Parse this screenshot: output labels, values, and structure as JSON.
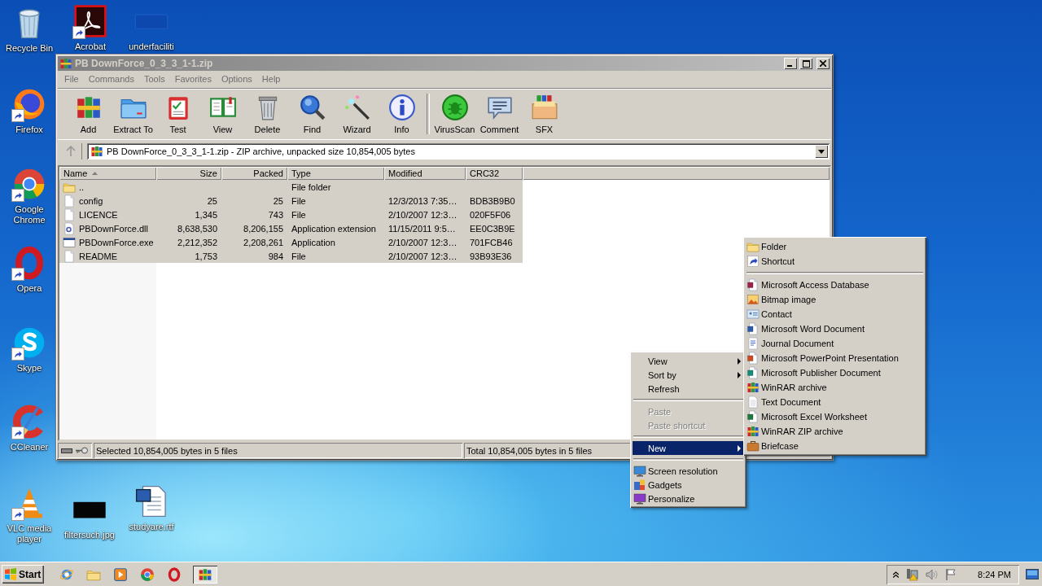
{
  "desktop_icons": [
    {
      "label": "Recycle Bin",
      "kind": "recycle",
      "shortcut": false
    },
    {
      "label": "Acrobat",
      "kind": "acrobat",
      "shortcut": true
    },
    {
      "label": "underfaciliti",
      "kind": "blank",
      "shortcut": false
    },
    {
      "label": "Firefox",
      "kind": "firefox",
      "shortcut": true
    },
    {
      "label": "Google Chrome",
      "kind": "chrome",
      "shortcut": true
    },
    {
      "label": "Opera",
      "kind": "opera",
      "shortcut": true
    },
    {
      "label": "Skype",
      "kind": "skype",
      "shortcut": true
    },
    {
      "label": "CCleaner",
      "kind": "ccleaner",
      "shortcut": true
    },
    {
      "label": "VLC media player",
      "kind": "vlc",
      "shortcut": true
    },
    {
      "label": "filtersuch.jpg",
      "kind": "image",
      "shortcut": false
    },
    {
      "label": "studyare.rtf",
      "kind": "word",
      "shortcut": false
    }
  ],
  "window": {
    "title": "PB DownForce_0_3_3_1-1.zip",
    "menu": [
      "File",
      "Commands",
      "Tools",
      "Favorites",
      "Options",
      "Help"
    ],
    "toolbar_groups": [
      [
        {
          "label": "Add",
          "kind": "add"
        },
        {
          "label": "Extract To",
          "kind": "extract"
        },
        {
          "label": "Test",
          "kind": "test"
        },
        {
          "label": "View",
          "kind": "view"
        },
        {
          "label": "Delete",
          "kind": "delete"
        },
        {
          "label": "Find",
          "kind": "find"
        },
        {
          "label": "Wizard",
          "kind": "wizard"
        },
        {
          "label": "Info",
          "kind": "info"
        }
      ],
      [
        {
          "label": "VirusScan",
          "kind": "virusscan"
        },
        {
          "label": "Comment",
          "kind": "comment"
        },
        {
          "label": "SFX",
          "kind": "sfx"
        }
      ]
    ],
    "address": "PB DownForce_0_3_3_1-1.zip - ZIP archive, unpacked size 10,854,005 bytes",
    "columns": [
      {
        "label": "Name",
        "sorted": true
      },
      {
        "label": "Size",
        "sorted": false
      },
      {
        "label": "Packed",
        "sorted": false
      },
      {
        "label": "Type",
        "sorted": false
      },
      {
        "label": "Modified",
        "sorted": false
      },
      {
        "label": "CRC32",
        "sorted": false
      }
    ],
    "rows": [
      {
        "kind": "folder",
        "name": "..",
        "type": "File folder",
        "selected": true
      },
      {
        "kind": "file",
        "name": "config",
        "size": "25",
        "packed": "25",
        "type": "File",
        "modified": "12/3/2013 7:35…",
        "crc32": "BDB3B9B0",
        "selected": true
      },
      {
        "kind": "file",
        "name": "LICENCE",
        "size": "1,345",
        "packed": "743",
        "type": "File",
        "modified": "2/10/2007 12:3…",
        "crc32": "020F5F06",
        "selected": true
      },
      {
        "kind": "dll",
        "name": "PBDownForce.dll",
        "size": "8,638,530",
        "packed": "8,206,155",
        "type": "Application extension",
        "modified": "11/15/2011 9:5…",
        "crc32": "EE0C3B9E",
        "selected": true
      },
      {
        "kind": "exe",
        "name": "PBDownForce.exe",
        "size": "2,212,352",
        "packed": "2,208,261",
        "type": "Application",
        "modified": "2/10/2007 12:3…",
        "crc32": "701FCB46",
        "selected": true
      },
      {
        "kind": "file",
        "name": "README",
        "size": "1,753",
        "packed": "984",
        "type": "File",
        "modified": "2/10/2007 12:3…",
        "crc32": "93B93E36",
        "selected": true
      }
    ],
    "status": {
      "selected": "Selected 10,854,005 bytes in 5 files",
      "total": "Total 10,854,005 bytes in 5 files"
    }
  },
  "context_menu": {
    "items": [
      {
        "kind": "item",
        "label": "View",
        "submenu": true,
        "disabled": false,
        "selected": false
      },
      {
        "kind": "item",
        "label": "Sort by",
        "submenu": true,
        "disabled": false,
        "selected": false
      },
      {
        "kind": "item",
        "label": "Refresh",
        "submenu": false,
        "disabled": false,
        "selected": false
      },
      {
        "kind": "separator"
      },
      {
        "kind": "item",
        "label": "Paste",
        "submenu": false,
        "disabled": true,
        "selected": false
      },
      {
        "kind": "item",
        "label": "Paste shortcut",
        "submenu": false,
        "disabled": true,
        "selected": false
      },
      {
        "kind": "separator"
      },
      {
        "kind": "item",
        "label": "New",
        "submenu": true,
        "disabled": false,
        "selected": true
      },
      {
        "kind": "separator"
      },
      {
        "kind": "screen",
        "label": "Screen resolution",
        "submenu": false,
        "disabled": false,
        "selected": false
      },
      {
        "kind": "gadgets",
        "label": "Gadgets",
        "submenu": false,
        "disabled": false,
        "selected": false
      },
      {
        "kind": "personalize",
        "label": "Personalize",
        "submenu": false,
        "disabled": false,
        "selected": false
      }
    ]
  },
  "new_submenu": {
    "items": [
      {
        "kind": "folder",
        "label": "Folder"
      },
      {
        "kind": "shortcut",
        "label": "Shortcut"
      },
      {
        "kind": "separator"
      },
      {
        "kind": "access",
        "label": "Microsoft Access Database"
      },
      {
        "kind": "bitmap",
        "label": "Bitmap image"
      },
      {
        "kind": "contact",
        "label": "Contact"
      },
      {
        "kind": "worddoc",
        "label": "Microsoft Word Document"
      },
      {
        "kind": "journal",
        "label": "Journal Document"
      },
      {
        "kind": "powerpoint",
        "label": "Microsoft PowerPoint Presentation"
      },
      {
        "kind": "publisher",
        "label": "Microsoft Publisher Document"
      },
      {
        "kind": "winrar",
        "label": "WinRAR archive"
      },
      {
        "kind": "text",
        "label": "Text Document"
      },
      {
        "kind": "excel",
        "label": "Microsoft Excel Worksheet"
      },
      {
        "kind": "winrar",
        "label": "WinRAR ZIP archive"
      },
      {
        "kind": "briefcase",
        "label": "Briefcase"
      }
    ]
  },
  "taskbar": {
    "start": "Start",
    "apps": [
      {
        "kind": "ie",
        "active": false
      },
      {
        "kind": "explorer",
        "active": false
      },
      {
        "kind": "media",
        "active": false
      },
      {
        "kind": "chrome",
        "active": false
      },
      {
        "kind": "opera",
        "active": false
      },
      {
        "kind": "winrar",
        "active": true
      }
    ],
    "time": "8:24 PM"
  }
}
